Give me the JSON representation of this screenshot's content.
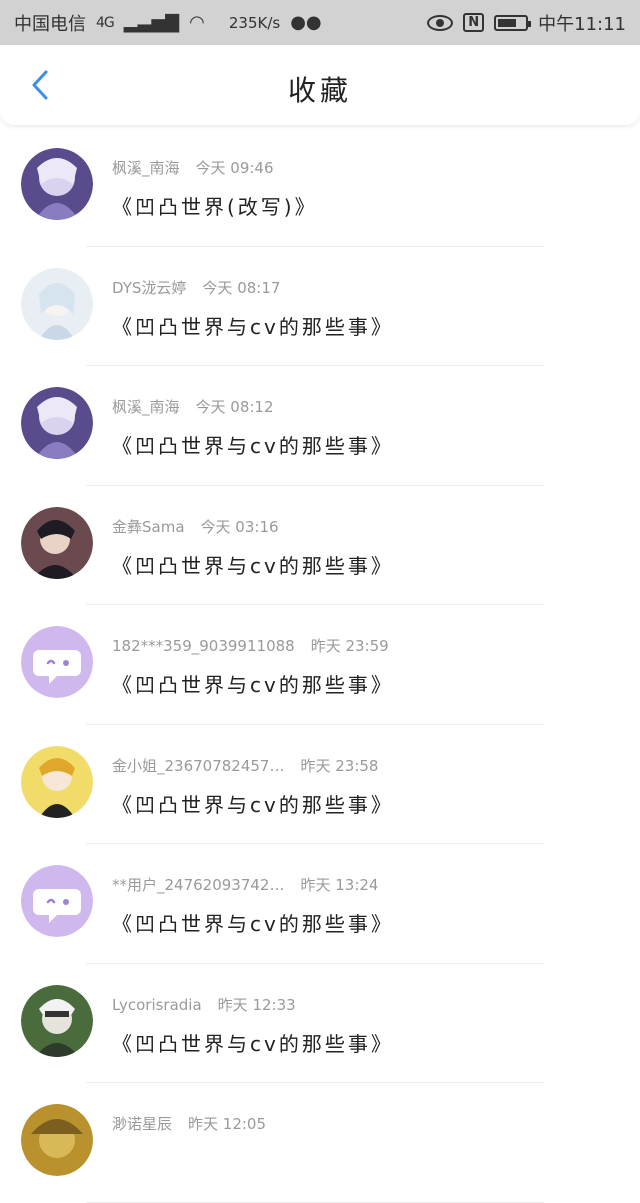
{
  "status": {
    "carrier": "中国电信",
    "network": "4G",
    "speed": "235K/s",
    "time": "中午11:11",
    "battery_level": 0.7
  },
  "header": {
    "title": "收藏",
    "back_icon": "chevron-left-icon",
    "accent_color": "#3b8fe8"
  },
  "items": [
    {
      "name": "枫溪_南海",
      "time": "今天 09:46",
      "content": "《凹凸世界(改写)》",
      "avatar": "anime-purple"
    },
    {
      "name": "DYS泷云婷",
      "time": "今天 08:17",
      "content": "《凹凸世界与cv的那些事》",
      "avatar": "anime-light"
    },
    {
      "name": "枫溪_南海",
      "time": "今天 08:12",
      "content": "《凹凸世界与cv的那些事》",
      "avatar": "anime-purple"
    },
    {
      "name": "金彝Sama",
      "time": "今天 03:16",
      "content": "《凹凸世界与cv的那些事》",
      "avatar": "anime-dark"
    },
    {
      "name": "182***359_9039911088",
      "time": "昨天 23:59",
      "content": "《凹凸世界与cv的那些事》",
      "avatar": "default-chat"
    },
    {
      "name": "金小姐_23670782457…",
      "time": "昨天 23:58",
      "content": "《凹凸世界与cv的那些事》",
      "avatar": "anime-yellow"
    },
    {
      "name": "**用户_24762093742…",
      "time": "昨天 13:24",
      "content": "《凹凸世界与cv的那些事》",
      "avatar": "default-chat"
    },
    {
      "name": "Lycorisradia",
      "time": "昨天 12:33",
      "content": "《凹凸世界与cv的那些事》",
      "avatar": "anime-green"
    },
    {
      "name": "渺诺星辰",
      "time": "昨天 12:05",
      "content": "",
      "avatar": "anime-orange"
    }
  ]
}
